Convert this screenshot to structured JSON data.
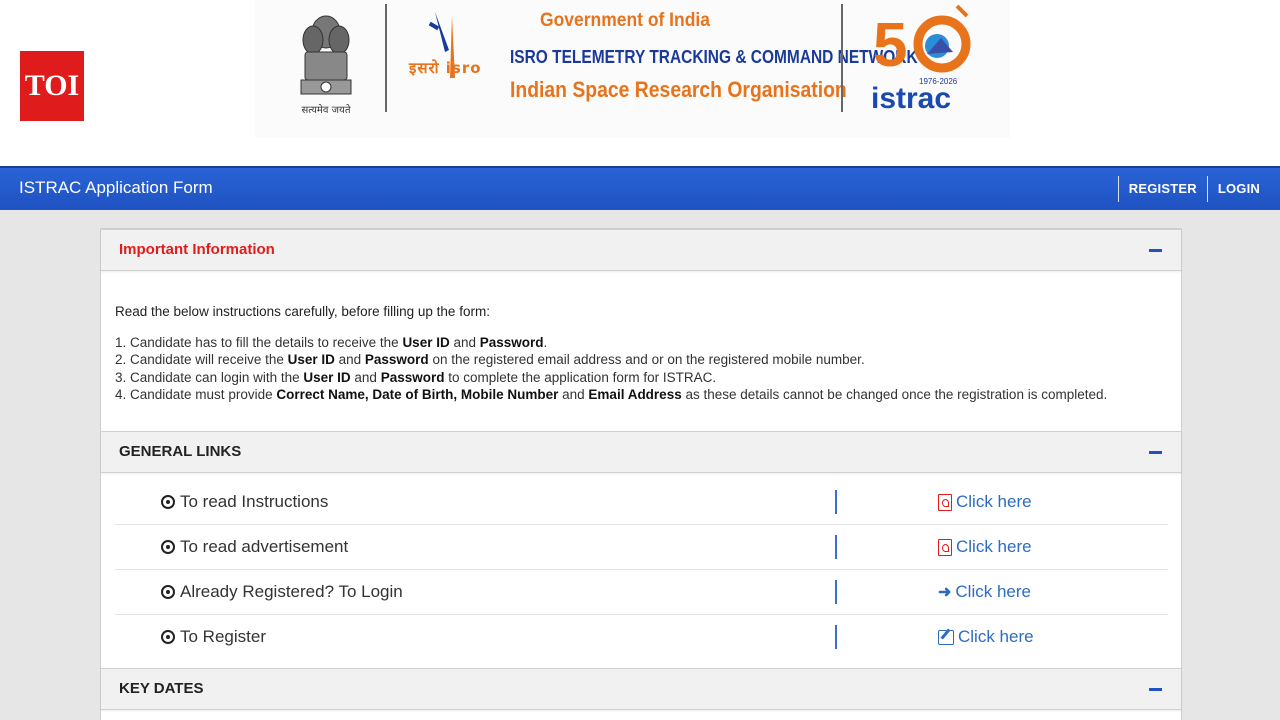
{
  "badge": {
    "text": "TOI"
  },
  "banner": {
    "gov": "Government of India",
    "network": "ISRO TELEMETRY TRACKING & COMMAND NETWORK",
    "org": "Indian Space Research Organisation",
    "isro_text": "इसरो isro",
    "motto": "सत्यमेव जयते",
    "istrac_years": "1976-2026",
    "istrac_text": "istrac",
    "istrac_50": "50"
  },
  "navbar": {
    "title": "ISTRAC Application Form",
    "register": "REGISTER",
    "login": "LOGIN"
  },
  "important": {
    "title": "Important Information",
    "intro": "Read the below instructions carefully, before filling up the form:",
    "items": [
      "1. Candidate has to fill the details to receive the |User ID| and |Password|.",
      "2. Candidate will receive the |User ID| and |Password| on the registered email address and or on the registered mobile number.",
      "3. Candidate can login with the |User ID| and |Password| to complete the application form for ISTRAC.",
      "4. Candidate must provide |Correct Name, Date of Birth, Mobile Number| and |Email Address| as these details cannot be changed once the registration is completed."
    ]
  },
  "general_links": {
    "title": "GENERAL LINKS",
    "rows": [
      {
        "label": "To read Instructions",
        "action": "Click here",
        "icon": "pdf-icon"
      },
      {
        "label": "To read advertisement",
        "action": "Click here",
        "icon": "pdf-icon"
      },
      {
        "label": "Already Registered? To Login",
        "action": "Click here",
        "icon": "sign-in-icon"
      },
      {
        "label": "To Register",
        "action": "Click here",
        "icon": "edit-icon"
      }
    ]
  },
  "key_dates": {
    "title": "KEY DATES"
  },
  "colors": {
    "navbar": "#1f52c2",
    "important_title": "#e21b1b",
    "link": "#2d6cc0",
    "toi": "#e01b1b"
  }
}
